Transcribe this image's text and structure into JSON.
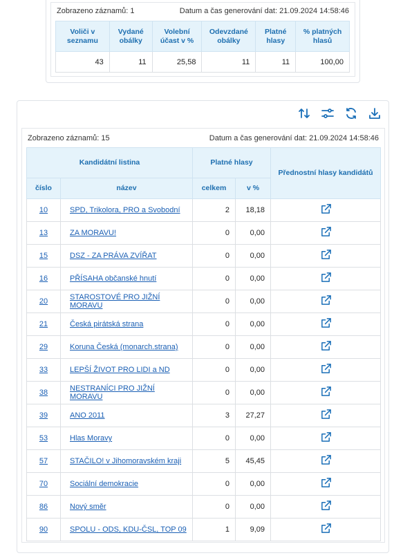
{
  "summary": {
    "records_label": "Zobrazeno záznamů: 1",
    "generated_label": "Datum a čas generování dat: 21.09.2024 14:58:46",
    "headers": [
      "Voliči v seznamu",
      "Vydané obálky",
      "Volební účast v %",
      "Odevzdané obálky",
      "Platné hlasy",
      "% platných hlasů"
    ],
    "values": [
      "43",
      "11",
      "25,58",
      "11",
      "11",
      "100,00"
    ]
  },
  "toolbar": {
    "icons": [
      "sort-icon",
      "filter-settings-icon",
      "refresh-icon",
      "download-icon"
    ]
  },
  "parties": {
    "records_label": "Zobrazeno záznamů: 15",
    "generated_label": "Datum a čas generování dat: 21.09.2024 14:58:46",
    "header_group": "Kandidátní listina",
    "header_valid": "Platné hlasy",
    "header_pref": "Přednostní hlasy kandidátů",
    "col_number": "číslo",
    "col_name": "název",
    "col_total": "celkem",
    "col_pct": "v %",
    "rows": [
      {
        "num": "10",
        "name": "SPD, Trikolora, PRO a Svobodní",
        "total": "2",
        "pct": "18,18"
      },
      {
        "num": "13",
        "name": "ZA MORAVU!",
        "total": "0",
        "pct": "0,00"
      },
      {
        "num": "15",
        "name": "DSZ - ZA PRÁVA ZVÍŘAT",
        "total": "0",
        "pct": "0,00"
      },
      {
        "num": "16",
        "name": "PŘÍSAHA občanské hnutí",
        "total": "0",
        "pct": "0,00"
      },
      {
        "num": "20",
        "name": "STAROSTOVÉ PRO JIŽNÍ MORAVU",
        "total": "0",
        "pct": "0,00"
      },
      {
        "num": "21",
        "name": "Česká pirátská strana",
        "total": "0",
        "pct": "0,00"
      },
      {
        "num": "29",
        "name": "Koruna Česká (monarch.strana)",
        "total": "0",
        "pct": "0,00"
      },
      {
        "num": "33",
        "name": "LEPŠÍ ŽIVOT PRO LIDI a ND",
        "total": "0",
        "pct": "0,00"
      },
      {
        "num": "38",
        "name": "NESTRANÍCI PRO JIŽNÍ MORAVU",
        "total": "0",
        "pct": "0,00"
      },
      {
        "num": "39",
        "name": "ANO 2011",
        "total": "3",
        "pct": "27,27"
      },
      {
        "num": "53",
        "name": "Hlas Moravy",
        "total": "0",
        "pct": "0,00"
      },
      {
        "num": "57",
        "name": "STAČILO! v Jihomoravském kraji",
        "total": "5",
        "pct": "45,45"
      },
      {
        "num": "70",
        "name": "Sociální demokracie",
        "total": "0",
        "pct": "0,00"
      },
      {
        "num": "86",
        "name": "Nový směr",
        "total": "0",
        "pct": "0,00"
      },
      {
        "num": "90",
        "name": "SPOLU - ODS, KDU-ČSL, TOP 09",
        "total": "1",
        "pct": "9,09"
      }
    ]
  },
  "colors": {
    "header_bg": "#e5f3fb",
    "header_text": "#1e6fb0",
    "link": "#1a5fb4",
    "icon": "#1a6fb8"
  }
}
